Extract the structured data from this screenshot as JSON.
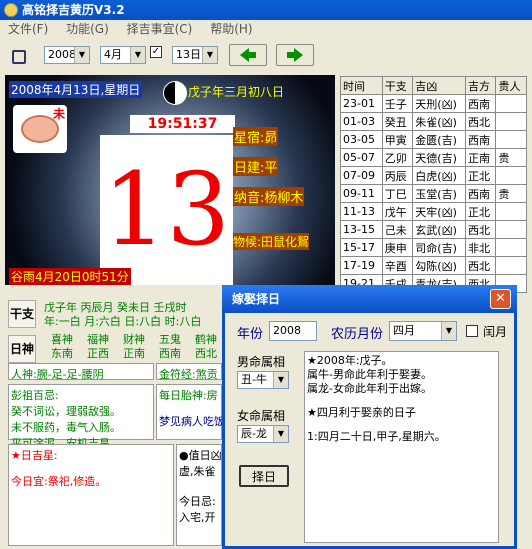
{
  "window": {
    "title": "高铭择吉黄历V3.2"
  },
  "menu": {
    "items": [
      "文件(F)",
      "功能(G)",
      "择吉事宜(C)",
      "帮助(H)"
    ]
  },
  "toolbar": {
    "year": "2008",
    "month": "4月",
    "day": "13日"
  },
  "calendar": {
    "date_line": "2008年4月13日,星期日",
    "lunar_line": "戊子年三月初八日",
    "zodiac": "未",
    "clock": "19:51:37",
    "day_number": "13",
    "xingxiu": "星宿:昴",
    "rijian": "日建:平",
    "nayin": "纳音:杨柳木",
    "wuhou": "物候:田鼠化鴽",
    "jieqi": "谷雨4月20日0时51分"
  },
  "hours": {
    "headers": [
      "时间",
      "干支",
      "吉凶",
      "吉方",
      "贵人"
    ],
    "rows": [
      [
        "23-01",
        "壬子",
        "天刑(凶)",
        "西南",
        ""
      ],
      [
        "01-03",
        "癸丑",
        "朱雀(凶)",
        "西北",
        ""
      ],
      [
        "03-05",
        "甲寅",
        "金匮(吉)",
        "西南",
        ""
      ],
      [
        "05-07",
        "乙卯",
        "天德(吉)",
        "正南",
        "贵"
      ],
      [
        "07-09",
        "丙辰",
        "白虎(凶)",
        "正北",
        ""
      ],
      [
        "09-11",
        "丁巳",
        "玉堂(吉)",
        "西南",
        "贵"
      ],
      [
        "11-13",
        "戊午",
        "天牢(凶)",
        "正北",
        ""
      ],
      [
        "13-15",
        "己未",
        "玄武(凶)",
        "西北",
        ""
      ],
      [
        "15-17",
        "庚申",
        "司命(吉)",
        "非北",
        ""
      ],
      [
        "17-19",
        "辛酉",
        "勾陈(凶)",
        "西北",
        ""
      ],
      [
        "19-21",
        "壬戌",
        "青龙(吉)",
        "西北",
        ""
      ]
    ]
  },
  "ganzhi": {
    "label": "干支",
    "line1": "戊子年 丙辰月 癸未日 壬戌时",
    "line2": "年:一白 月:六白 日:八白 时:八白"
  },
  "rishen": {
    "label": "日神",
    "gods": [
      [
        "喜神",
        "东南"
      ],
      [
        "福神",
        "正西"
      ],
      [
        "财神",
        "正南"
      ],
      [
        "五鬼",
        "西南"
      ],
      [
        "鹤神",
        "西北"
      ]
    ]
  },
  "info": {
    "renshen": "人神:腕-足-足-腰阴",
    "jinfu": "金符经:煞贡",
    "pengzu_title": "彭祖百忌:",
    "pengzu_lines": [
      "癸不词讼，理弱敌强。",
      "未不服药，毒气入肠。",
      "平可涂泥，安机吉昌。"
    ],
    "daily_title": "每日胎神:房",
    "dream": "梦见病人吃饭",
    "jixing_title": "★日吉星:",
    "yi": "今日宜:祭祀,修造。",
    "zhishen_lines": [
      "●值日凶",
      "虚,朱雀",
      "",
      "今日忌:",
      "入宅,开"
    ]
  },
  "dialog": {
    "title": "嫁娶择日",
    "year_label": "年份",
    "year": "2008",
    "month_label": "农历月份",
    "month": "四月",
    "leap_label": "闰月",
    "male_label": "男命属相",
    "male": "丑-牛",
    "female_label": "女命属相",
    "female": "辰-龙",
    "button": "择日",
    "result_lines": [
      "★2008年:戊子。",
      "属牛-男命此年利于娶妻。",
      "属龙-女命此年利于出嫁。",
      "",
      "★四月利于娶亲的日子",
      "",
      "1:四月二十日,甲子,星期六。"
    ]
  }
}
